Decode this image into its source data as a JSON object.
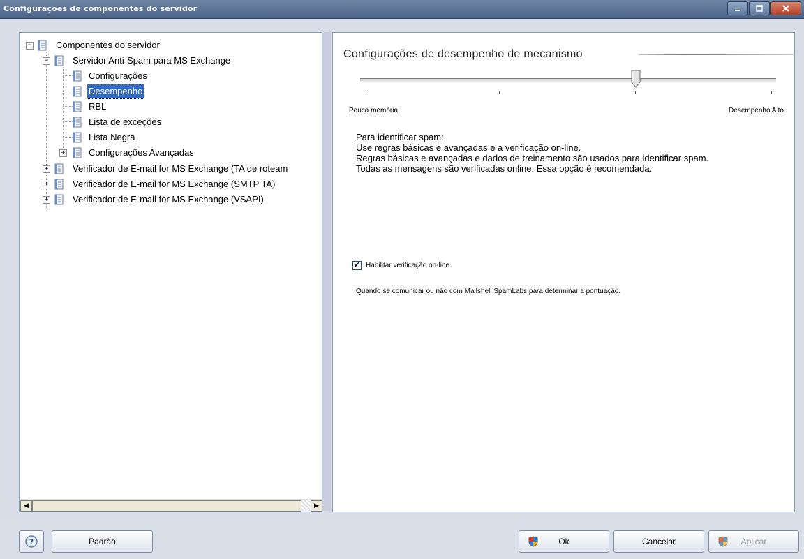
{
  "window": {
    "title": "Configurações de componentes do servidor"
  },
  "tree": {
    "items": [
      {
        "label": "Componentes do servidor"
      },
      {
        "label": "Servidor Anti-Spam para MS Exchange"
      },
      {
        "label": "Configurações"
      },
      {
        "label": "Desempenho"
      },
      {
        "label": "RBL"
      },
      {
        "label": "Lista de exceções"
      },
      {
        "label": "Lista Negra"
      },
      {
        "label": "Configurações Avançadas"
      },
      {
        "label": "Verificador de E-mail for MS Exchange (TA de roteam"
      },
      {
        "label": "Verificador de E-mail for MS Exchange (SMTP TA)"
      },
      {
        "label": "Verificador de E-mail for MS Exchange (VSAPI)"
      }
    ],
    "selected_index": 3
  },
  "panel": {
    "title": "Configurações de desempenho de mecanismo",
    "slider": {
      "min_label": "Pouca memória",
      "max_label": "Desempenho Alto",
      "value": 2,
      "max": 3
    },
    "description": [
      "Para identificar spam:",
      "Use regras básicas e avançadas e a verificação on-line.",
      "Regras básicas e avançadas e dados de treinamento são usados para identificar spam.",
      "Todas as mensagens são verificadas online. Essa opção é recomendada."
    ],
    "checkbox": {
      "label": "Habilitar verificação on-line",
      "checked": true
    },
    "help_text": "Quando se comunicar ou não com Mailshell SpamLabs para determinar a pontuação."
  },
  "footer": {
    "help_label": "?",
    "default_label": "Padrão",
    "ok_label": "Ok",
    "cancel_label": "Cancelar",
    "apply_label": "Aplicar"
  },
  "colors": {
    "titlebar": "#4c6488",
    "selection": "#316ac5",
    "panel_bg": "#d8dde8"
  }
}
